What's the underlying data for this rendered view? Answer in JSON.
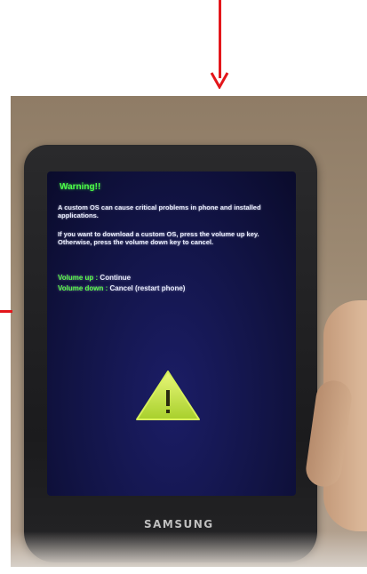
{
  "screen": {
    "title": "Warning!!",
    "paragraph1": "A custom OS can cause critical problems in phone and installed applications.",
    "paragraph2": "If you want to download a custom OS, press the volume up key. Otherwise, press the volume down key to cancel.",
    "keys": [
      {
        "key": "Volume up :",
        "action": "Continue"
      },
      {
        "key": "Volume down :",
        "action": "Cancel (restart phone)"
      }
    ]
  },
  "device": {
    "brand": "SAMSUNG"
  },
  "colors": {
    "warning_green": "#4dff4a",
    "arrow_red": "#e3161b",
    "screen_blue": "#121446",
    "triangle_yellow": "#c8e63c"
  },
  "icons": {
    "annotation": "red-down-arrow-icon",
    "warning": "warning-triangle-icon"
  }
}
